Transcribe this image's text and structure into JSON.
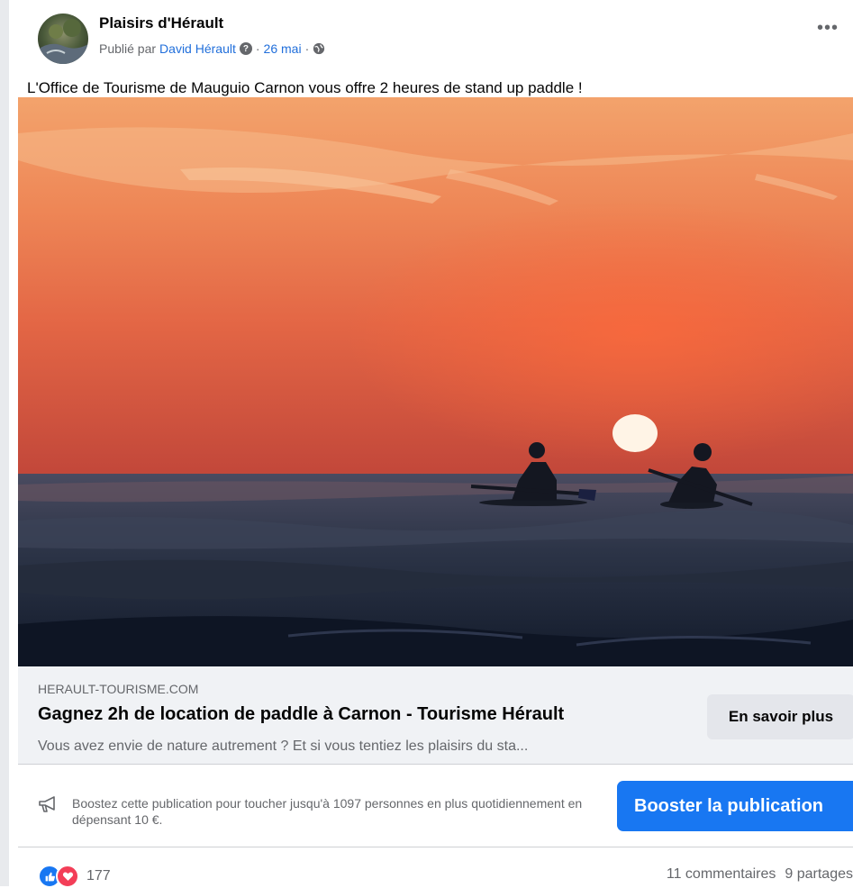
{
  "post": {
    "page_name": "Plaisirs d'Hérault",
    "published_by_prefix": "Publié par",
    "author": "David Hérault",
    "separator": "·",
    "date": "26 mai",
    "more_label": "•••",
    "text": "L'Office de Tourisme de Mauguio Carnon vous offre 2 heures de stand up paddle !",
    "image_icon": "sunset-paddle-photo"
  },
  "link_preview": {
    "domain": "HERAULT-TOURISME.COM",
    "title": "Gagnez 2h de location de paddle à Carnon - Tourisme Hérault",
    "description": "Vous avez envie de nature autrement ? Et si vous tentiez les plaisirs du sta...",
    "button_label": "En savoir plus"
  },
  "boost": {
    "icon": "megaphone-icon",
    "text": "Boostez cette publication pour toucher jusqu'à 1097 personnes en plus quotidiennement en dépensant 10 €.",
    "button_label": "Booster la publication"
  },
  "engagement": {
    "reactions_count": "177",
    "comments": "11 commentaires",
    "shares": "9 partages"
  },
  "colors": {
    "accent": "#1877f2",
    "link": "#216fdb",
    "muted": "#65676b",
    "love": "#f33e58"
  }
}
